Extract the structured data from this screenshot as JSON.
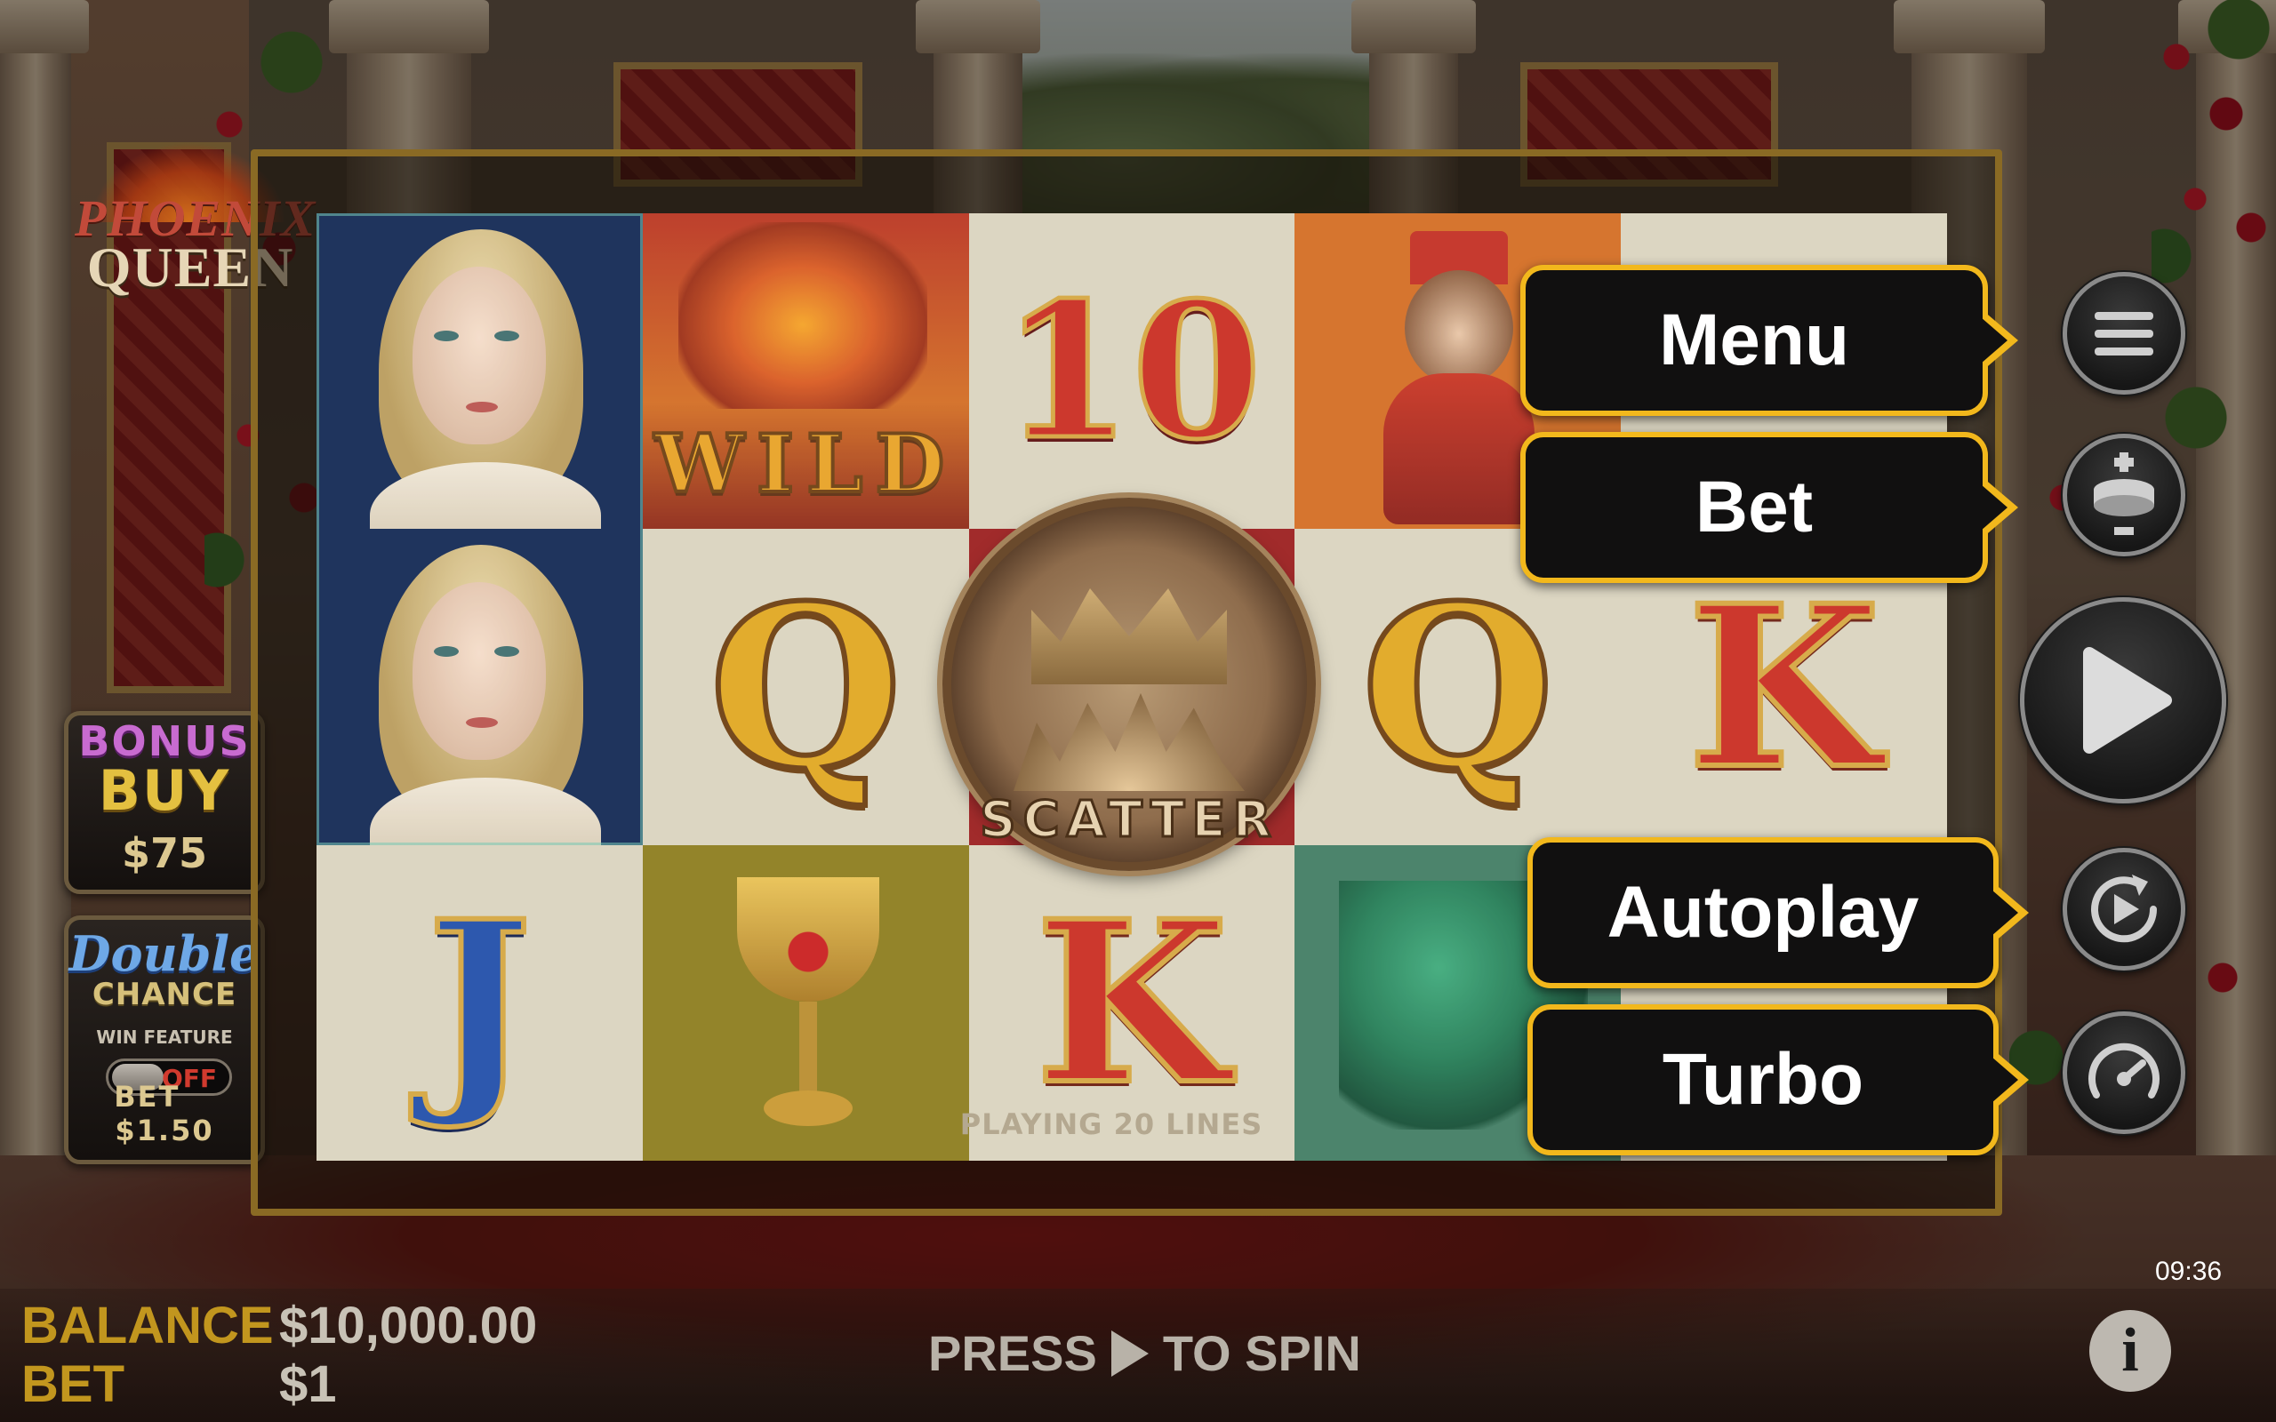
{
  "game": {
    "logo_line1": "PHOENIX",
    "logo_line2": "QUEEN"
  },
  "bonus_buy": {
    "title_line1": "BONUS",
    "title_line2": "BUY",
    "price": "$75"
  },
  "double_chance": {
    "title_line1": "Double",
    "title_line2": "CHANCE",
    "subtitle": "WIN FEATURE",
    "toggle_state": "OFF",
    "bet_label": "BET",
    "bet_value": "$1.50"
  },
  "reels": {
    "wild_label": "WILD",
    "scatter_label": "SCATTER",
    "ten_label": "10",
    "q_label": "Q",
    "k_label": "K",
    "j_label": "J",
    "lines_text": "PLAYING 20 LINES"
  },
  "tooltips": {
    "menu": "Menu",
    "bet": "Bet",
    "autoplay": "Autoplay",
    "turbo": "Turbo"
  },
  "icons": {
    "menu": "hamburger-menu-icon",
    "bet": "coin-stack-plus-minus-icon",
    "spin": "play-icon",
    "autoplay": "autoplay-loop-icon",
    "turbo": "speedometer-icon",
    "info": "info-icon"
  },
  "status": {
    "balance_label": "BALANCE",
    "balance_value": "$10,000.00",
    "bet_label": "BET",
    "bet_value": "$1",
    "press_label": "PRESS",
    "to_spin_label": "TO SPIN",
    "clock": "09:36"
  },
  "colors": {
    "tooltip_border": "#f2b81c",
    "label_gold": "#c2961e",
    "toggle_off": "#d13a2e"
  }
}
